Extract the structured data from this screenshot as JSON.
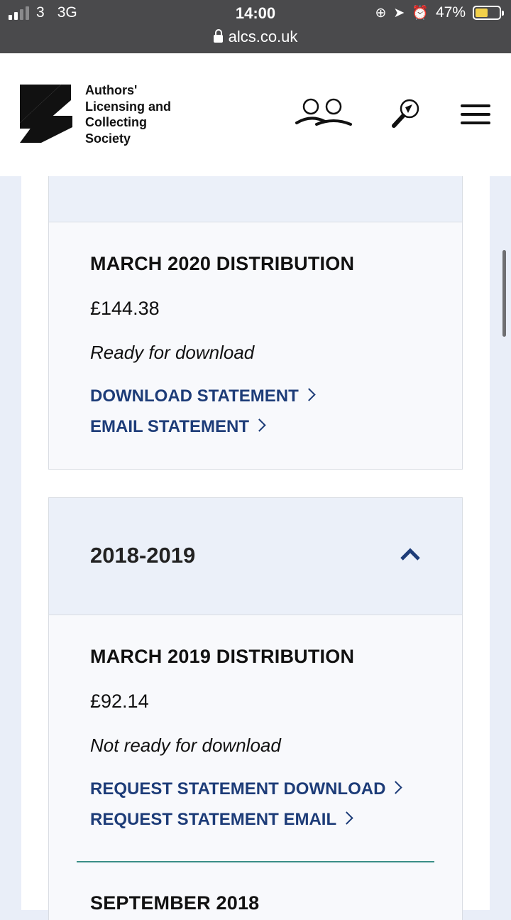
{
  "status_bar": {
    "carrier": "3",
    "network": "3G",
    "time": "14:00",
    "url": "alcs.co.uk",
    "battery_percent": "47%",
    "battery_level": 0.47,
    "icons": [
      "signal-icon",
      "rotation-lock-icon",
      "location-icon",
      "alarm-icon",
      "battery-icon"
    ]
  },
  "header": {
    "logo_lines": [
      "Authors'",
      "Licensing and",
      "Collecting",
      "Society"
    ],
    "icons": [
      "users-icon",
      "search-icon",
      "menu-icon"
    ]
  },
  "sections": {
    "march2020": {
      "title": "MARCH 2020 DISTRIBUTION",
      "amount": "£144.38",
      "status": "Ready for download",
      "links": [
        "DOWNLOAD STATEMENT",
        "EMAIL STATEMENT"
      ]
    },
    "year_2018_2019": {
      "label": "2018-2019",
      "expanded": true
    },
    "march2019": {
      "title": "MARCH 2019 DISTRIBUTION",
      "amount": "£92.14",
      "status": "Not ready for download",
      "links": [
        "REQUEST STATEMENT DOWNLOAD",
        "REQUEST STATEMENT EMAIL"
      ]
    },
    "september2018": {
      "title": "SEPTEMBER 2018"
    }
  },
  "colors": {
    "status_bar": "#4a4a4c",
    "page_bg": "#e9eef8",
    "section_header_bg": "#ebf0f9",
    "link": "#1d3c78",
    "divider": "#3a8e87"
  }
}
